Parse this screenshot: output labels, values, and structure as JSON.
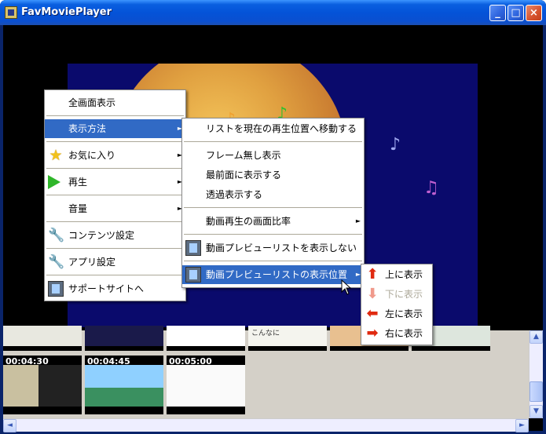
{
  "window": {
    "title": "FavMoviePlayer"
  },
  "titlebar_buttons": {
    "minimize": "_",
    "maximize": "□",
    "close": "×"
  },
  "context_menu": {
    "items": [
      {
        "label": "全画面表示"
      },
      {
        "label": "表示方法",
        "has_submenu": true
      },
      {
        "label": "お気に入り",
        "icon": "star-icon",
        "has_submenu": true
      },
      {
        "label": "再生",
        "icon": "play-icon",
        "has_submenu": true
      },
      {
        "label": "音量",
        "has_submenu": true
      },
      {
        "label": "コンテンツ設定",
        "icon": "wrench-icon"
      },
      {
        "label": "アプリ設定",
        "icon": "wrench-icon"
      },
      {
        "label": "サポートサイトへ",
        "icon": "film-icon"
      }
    ]
  },
  "submenu_display": {
    "items": [
      {
        "label": "リストを現在の再生位置へ移動する"
      },
      {
        "label": "フレーム無し表示"
      },
      {
        "label": "最前面に表示する"
      },
      {
        "label": "透過表示する"
      },
      {
        "label": "動画再生の画面比率",
        "has_submenu": true
      },
      {
        "label": "動画プレビューリストを表示しない",
        "icon": "film-icon"
      },
      {
        "label": "動画プレビューリストの表示位置",
        "icon": "film-icon",
        "has_submenu": true
      }
    ]
  },
  "submenu_position": {
    "items": [
      {
        "label": "上に表示",
        "icon": "arrow-up-icon"
      },
      {
        "label": "下に表示",
        "icon": "arrow-down-icon",
        "disabled": true
      },
      {
        "label": "左に表示",
        "icon": "arrow-left-icon"
      },
      {
        "label": "右に表示",
        "icon": "arrow-right-icon"
      }
    ]
  },
  "preview_list": {
    "row2_times": [
      "00:04:30",
      "00:04:45",
      "00:05:00"
    ],
    "row1_caption": "こんなに"
  },
  "submenu_arrow": "►"
}
